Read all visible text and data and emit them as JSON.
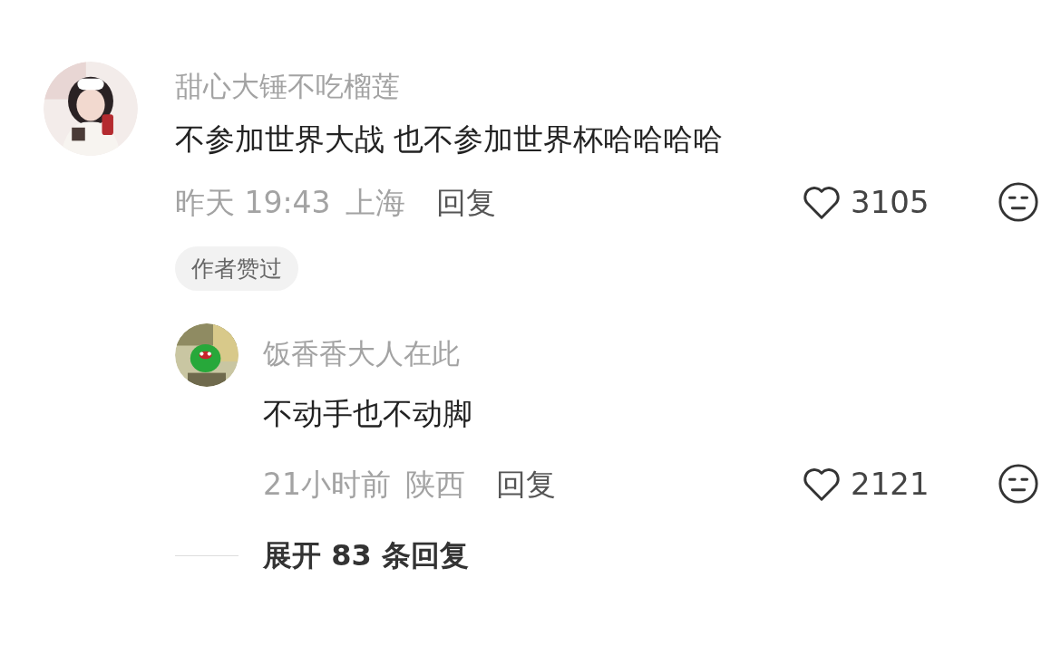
{
  "comment": {
    "author": "甜心大锤不吃榴莲",
    "text": "不参加世界大战 也不参加世界杯哈哈哈哈",
    "time": "昨天 19:43",
    "location": "上海",
    "reply_label": "回复",
    "likes": "3105",
    "author_liked_badge": "作者赞过",
    "replies": [
      {
        "author": "饭香香大人在此",
        "text": "不动手也不动脚",
        "time": "21小时前",
        "location": "陕西",
        "reply_label": "回复",
        "likes": "2121"
      }
    ],
    "expand_label": "展开 83 条回复"
  }
}
